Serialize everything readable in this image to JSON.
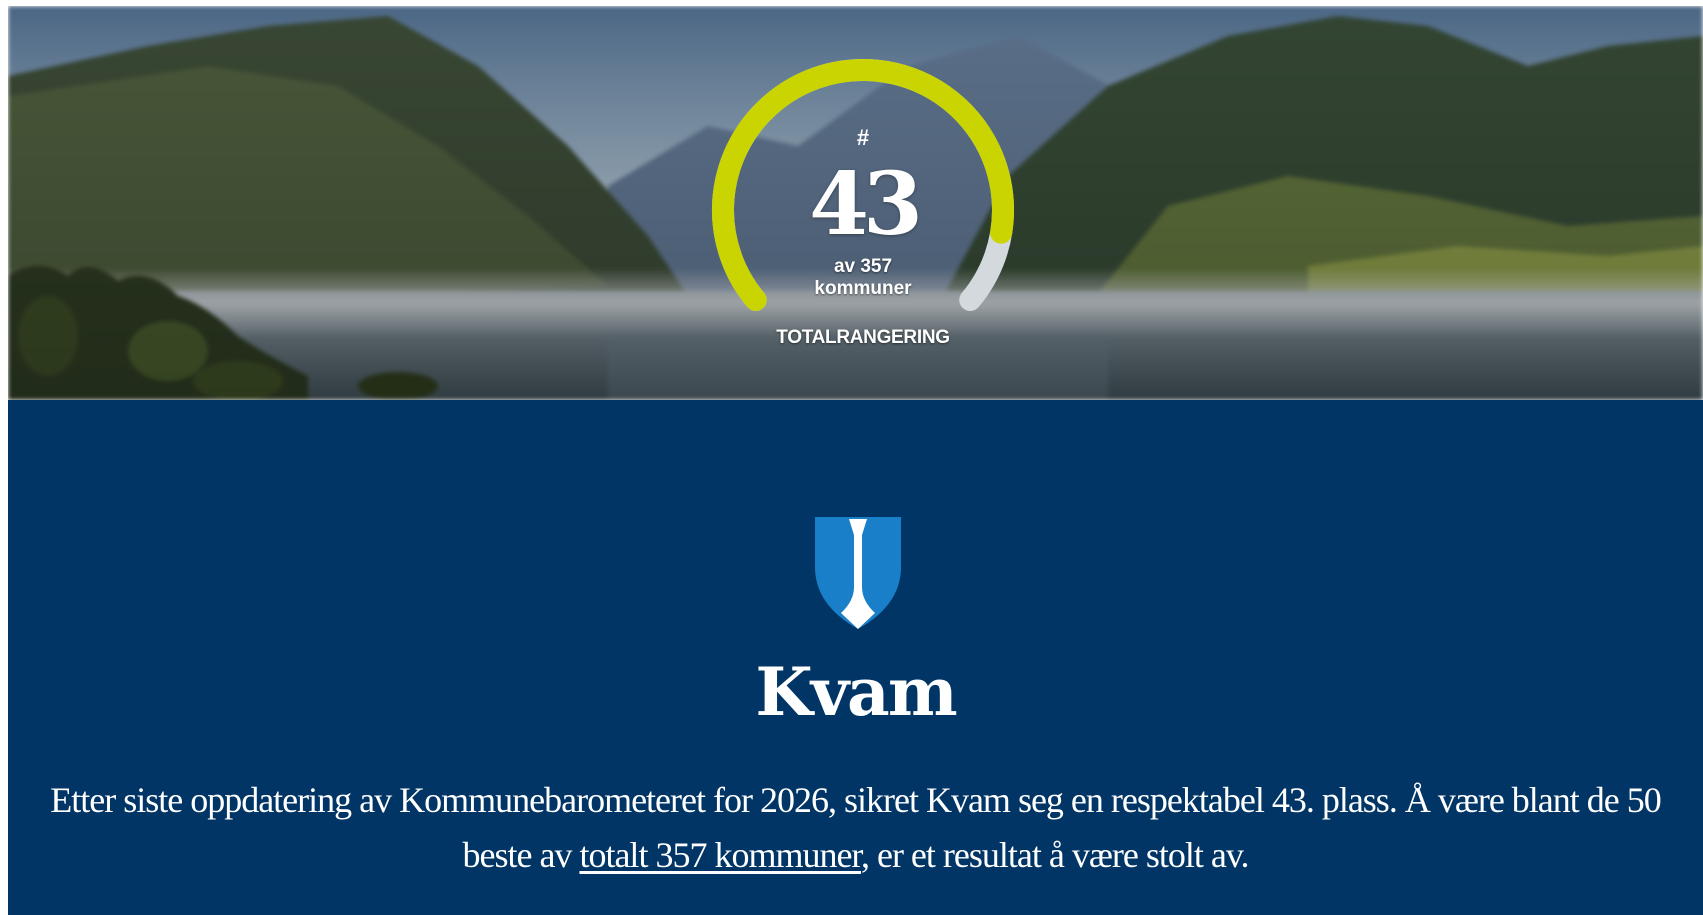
{
  "hero": {
    "rank_prefix": "#",
    "rank": "43",
    "rank_value": 43,
    "total_value": 357,
    "rank_of": "av 357",
    "rank_unit": "kommuner",
    "caption": "TOTALRANGERING",
    "gauge_colors": {
      "filled": "#c9d400",
      "remaining": "#d4d9de"
    }
  },
  "municipality": {
    "name": "Kvam",
    "crest_icon": "kvam-coat-of-arms",
    "crest_colors": {
      "field": "#1a7fc9",
      "charge": "#ffffff"
    }
  },
  "summary": {
    "text_before": "Etter siste oppdatering av Kommunebarometeret for 2026, sikret Kvam seg en respektabel 43. plass. Å være blant de 50 beste av ",
    "link_text": "totalt 357 kommuner",
    "text_after": ", er et resultat å være stolt av."
  },
  "colors": {
    "content_background": "#003566",
    "text": "#ffffff"
  }
}
